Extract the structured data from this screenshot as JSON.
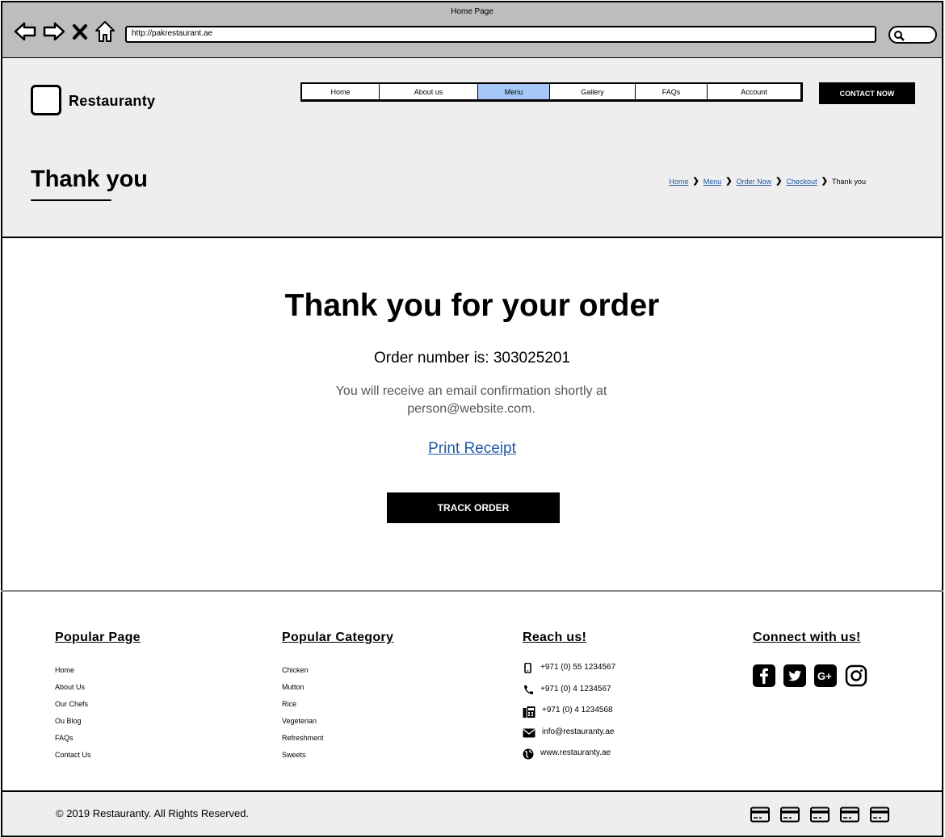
{
  "browser": {
    "window_title": "Home Page",
    "url": "http://pakrestaurant.ae",
    "nav_icons": [
      "back-arrow-icon",
      "forward-arrow-icon",
      "close-icon",
      "home-icon"
    ],
    "search_icon": "search-icon"
  },
  "header": {
    "brand": "Restauranty",
    "menu": [
      {
        "label": "Home",
        "active": false
      },
      {
        "label": "About us",
        "active": false
      },
      {
        "label": "Menu",
        "active": true
      },
      {
        "label": "Gallery",
        "active": false
      },
      {
        "label": "FAQs",
        "active": false
      },
      {
        "label": "Account",
        "active": false
      }
    ],
    "contact_button": "CONTACT NOW",
    "page_heading": "Thank you",
    "breadcrumb": [
      "Home",
      "Menu",
      "Order Now",
      "Checkout"
    ],
    "breadcrumb_current": "Thank you"
  },
  "main": {
    "title": "Thank you for your order",
    "order_number_label": "Order number is: ",
    "order_number": "303025201",
    "email_note": "You will receive an email confirmation shortly at person@website.com.",
    "print_link": "Print Receipt",
    "track_button": "TRACK ORDER"
  },
  "footer": {
    "popular_page": {
      "title": "Popular Page",
      "items": [
        "Home",
        "About Us",
        "Our Chefs",
        "Ou Blog",
        "FAQs",
        "Contact Us"
      ]
    },
    "popular_category": {
      "title": "Popular Category",
      "items": [
        "Chicken",
        "Mutton",
        "Rice",
        "Vegeterian",
        "Refreshment",
        "Sweets"
      ]
    },
    "reach_us": {
      "title": "Reach us!",
      "items": [
        {
          "icon": "mobile-phone-icon",
          "text": "+971 (0) 55 1234567"
        },
        {
          "icon": "phone-icon",
          "text": "+971 (0) 4 1234567"
        },
        {
          "icon": "fax-icon",
          "text": "+971 (0) 4 1234568"
        },
        {
          "icon": "envelope-icon",
          "text": "info@restauranty.ae"
        },
        {
          "icon": "globe-icon",
          "text": "www.restauranty.ae"
        }
      ]
    },
    "connect": {
      "title": "Connect with us!",
      "icons": [
        "facebook-icon",
        "twitter-icon",
        "google-plus-icon",
        "instagram-icon"
      ]
    },
    "copyright": "© 2019 Restauranty. All Rights Reserved.",
    "payment_icons": [
      "credit-card-icon",
      "credit-card-icon",
      "credit-card-icon",
      "credit-card-icon",
      "credit-card-icon"
    ]
  },
  "colors": {
    "chrome": "#bdbdbd",
    "header_bg": "#eeeeee",
    "active_menu": "#a4c7f5",
    "link": "#1f5aa6",
    "button": "#000000"
  }
}
